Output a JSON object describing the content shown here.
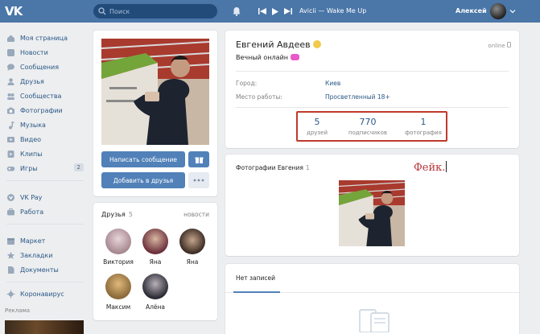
{
  "header": {
    "logo": "VK",
    "search_placeholder": "Поиск",
    "track": "Avicii — Wake Me Up",
    "user_name": "Алексей"
  },
  "nav": {
    "items": [
      {
        "label": "Моя страница",
        "icon": "home-icon"
      },
      {
        "label": "Новости",
        "icon": "news-icon"
      },
      {
        "label": "Сообщения",
        "icon": "messages-icon"
      },
      {
        "label": "Друзья",
        "icon": "friends-icon"
      },
      {
        "label": "Сообщества",
        "icon": "groups-icon"
      },
      {
        "label": "Фотографии",
        "icon": "camera-icon"
      },
      {
        "label": "Музыка",
        "icon": "music-icon"
      },
      {
        "label": "Видео",
        "icon": "video-icon"
      },
      {
        "label": "Клипы",
        "icon": "clips-icon"
      },
      {
        "label": "Игры",
        "icon": "games-icon",
        "badge": "2"
      },
      {
        "label": "VK Pay",
        "icon": "vkpay-icon"
      },
      {
        "label": "Работа",
        "icon": "work-icon"
      },
      {
        "label": "Маркет",
        "icon": "market-icon"
      },
      {
        "label": "Закладки",
        "icon": "bookmark-icon"
      },
      {
        "label": "Документы",
        "icon": "document-icon"
      },
      {
        "label": "Коронавирус",
        "icon": "virus-icon"
      }
    ],
    "ad_label": "Реклама"
  },
  "left_column": {
    "write_message": "Написать сообщение",
    "add_friend": "Добавить в друзья",
    "friends": {
      "title": "Друзья",
      "count": "5",
      "link": "новости",
      "list": [
        "Виктория",
        "Яна",
        "Яна",
        "Максим",
        "Алёна"
      ]
    }
  },
  "profile": {
    "name": "Евгений Авдеев",
    "online": "online",
    "status": "Вечный онлайн",
    "info": [
      {
        "label": "Город:",
        "value": "Киев"
      },
      {
        "label": "Место работы:",
        "value": "Просветленный 18+"
      }
    ],
    "counters": [
      {
        "value": "5",
        "label": "друзей"
      },
      {
        "value": "770",
        "label": "подписчиков"
      },
      {
        "value": "1",
        "label": "фотография"
      }
    ]
  },
  "photos": {
    "title": "Фотографии Евгения",
    "count": "1",
    "annotation": "Фейк."
  },
  "wall": {
    "tab": "Нет записей"
  },
  "colors": {
    "header": "#4a76a8",
    "accent": "#5181b8",
    "link": "#2a5885",
    "highlight_box": "#c0392b"
  }
}
